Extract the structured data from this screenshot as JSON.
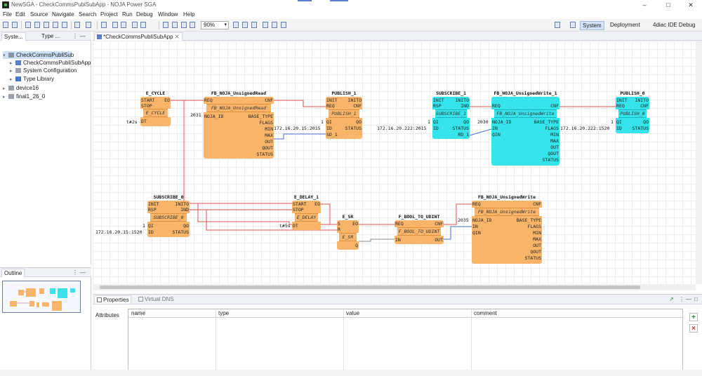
{
  "window": {
    "title": "NewSGA - CheckCommsPubiSubApp - NOJA Power SGA"
  },
  "menu": [
    "File",
    "Edit",
    "Source",
    "Navigate",
    "Search",
    "Project",
    "Run",
    "Debug",
    "Window",
    "Help"
  ],
  "toolbar": {
    "zoom": "90%"
  },
  "perspectives": {
    "system": "System",
    "deployment": "Deployment",
    "debug": "4diac IDE Debug"
  },
  "nav": {
    "tabs": [
      "Syste...",
      "Type ..."
    ],
    "tree": [
      {
        "label": "CheckCommsPubliSub",
        "selected": true
      },
      {
        "label": "CheckCommsPubliSubApp"
      },
      {
        "label": "System Configuration"
      },
      {
        "label": "Type Library"
      },
      {
        "label": "device16"
      },
      {
        "label": "final1_26_0"
      }
    ]
  },
  "outline": {
    "tab": "Outline"
  },
  "editor": {
    "tab": "*CheckCommsPubliSubApp"
  },
  "blocks": {
    "e_cycle": {
      "name": "E_CYCLE",
      "type": "E_CYCLE",
      "in": [
        "START",
        "STOP"
      ],
      "out": [
        "EO"
      ],
      "din": [
        "DT"
      ],
      "dout": [],
      "dt_val": "t#2s"
    },
    "fb_read": {
      "name": "FB_NOJA_UnsignedRead",
      "type": "FB_NOJA_UnsignedRead",
      "in": [
        "REQ"
      ],
      "out": [
        "CNF"
      ],
      "din": [
        "NOJA_ID"
      ],
      "dout": [
        "BASE_TYPE",
        "FLAGS",
        "MIN",
        "MAX",
        "OUT",
        "QOUT",
        "STATUS"
      ],
      "id_val": "2031"
    },
    "publish_1": {
      "name": "PUBLISH_1",
      "type": "PUBLISH_1",
      "in": [
        "INIT",
        "REQ"
      ],
      "out": [
        "INITO",
        "CNF"
      ],
      "din": [
        "QI",
        "ID",
        "SD_1"
      ],
      "dout": [
        "QO",
        "STATUS"
      ],
      "qi_val": "1",
      "id_val": "172.16.20.15:2015"
    },
    "subscribe_1": {
      "name": "SUBSCRIBE_1",
      "type": "SUBSCRIBE_1",
      "in": [
        "INIT",
        "RSP"
      ],
      "out": [
        "INITO",
        "IND"
      ],
      "din": [
        "QI",
        "ID"
      ],
      "dout": [
        "QO",
        "STATUS",
        "RD_1"
      ],
      "qi_val": "1",
      "id_val": "172.16.20.222:2015"
    },
    "fb_write_1": {
      "name": "FB_NOJA_UnsignedWrite_1",
      "type": "FB_NOJA_UnsignedWrite",
      "in": [
        "REQ"
      ],
      "out": [
        "CNF"
      ],
      "din": [
        "NOJA_ID",
        "IN",
        "QIN"
      ],
      "dout": [
        "BASE_TYPE",
        "FLAGS",
        "MIN",
        "MAX",
        "OUT",
        "QOUT",
        "STATUS"
      ],
      "id_val": "2030"
    },
    "publish_0": {
      "name": "PUBLISH_0",
      "type": "PUBLISH_0",
      "in": [
        "INIT",
        "REQ"
      ],
      "out": [
        "INITO",
        "CNF"
      ],
      "din": [
        "QI",
        "ID"
      ],
      "dout": [
        "QO",
        "STATUS"
      ],
      "qi_val": "1",
      "id_val": "172.16.20.222:1520"
    },
    "subscribe_0": {
      "name": "SUBSCRIBE_0",
      "type": "SUBSCRIBE_0",
      "in": [
        "INIT",
        "RSP"
      ],
      "out": [
        "INITO",
        "IND"
      ],
      "din": [
        "QI",
        "ID"
      ],
      "dout": [
        "QO",
        "STATUS"
      ],
      "qi_val": "1",
      "id_val": "172.16.20.15:1520"
    },
    "e_delay": {
      "name": "E_DELAY_1",
      "type": "E_DELAY",
      "in": [
        "START",
        "STOP"
      ],
      "out": [
        "EO"
      ],
      "din": [
        "DT"
      ],
      "dout": [],
      "dt_val": "t#5s"
    },
    "e_sr": {
      "name": "E_SR",
      "type": "E_SR",
      "in": [
        "S",
        "R"
      ],
      "out": [
        "EO"
      ],
      "din": [],
      "dout": [
        "Q"
      ]
    },
    "f_bool": {
      "name": "F_BOOL_TO_UDINT",
      "type": "F_BOOL_TO_UDINT",
      "in": [
        "REQ"
      ],
      "out": [
        "CNF"
      ],
      "din": [
        "IN"
      ],
      "dout": [
        "OUT"
      ]
    },
    "fb_write": {
      "name": "FB_NOJA_UnsignedWrite",
      "type": "FB_NOJA_UnsignedWrite",
      "in": [
        "REQ"
      ],
      "out": [
        "CNF"
      ],
      "din": [
        "NOJA_ID",
        "IN",
        "QIN"
      ],
      "dout": [
        "BASE_TYPE",
        "FLAGS",
        "MIN",
        "MAX",
        "OUT",
        "QOUT",
        "STATUS"
      ],
      "id_val": "2035"
    }
  },
  "properties": {
    "tabs": [
      "Properties",
      "Virtual DNS"
    ],
    "section": "Attributes",
    "columns": [
      "name",
      "type",
      "value",
      "comment"
    ]
  },
  "colors": {
    "fb_orange": "#f8b56a",
    "fb_cyan": "#37e3ea",
    "event_wire": "#e05252",
    "data_wire_bool": "#8a8a8a",
    "data_wire": "#4a6fd1"
  }
}
